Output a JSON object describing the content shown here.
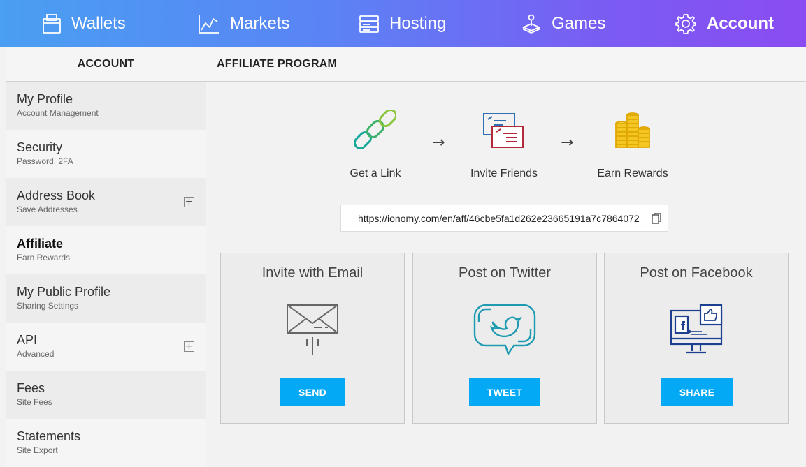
{
  "nav": {
    "items": [
      {
        "label": "Wallets",
        "icon": "wallet-icon"
      },
      {
        "label": "Markets",
        "icon": "chart-icon"
      },
      {
        "label": "Hosting",
        "icon": "server-icon"
      },
      {
        "label": "Games",
        "icon": "joystick-icon"
      },
      {
        "label": "Account",
        "icon": "gear-icon",
        "active": true
      }
    ]
  },
  "sidebar": {
    "header": "ACCOUNT",
    "items": [
      {
        "title": "My Profile",
        "sub": "Account Management"
      },
      {
        "title": "Security",
        "sub": "Password, 2FA"
      },
      {
        "title": "Address Book",
        "sub": "Save Addresses",
        "expandable": true
      },
      {
        "title": "Affiliate",
        "sub": "Earn Rewards",
        "active": true
      },
      {
        "title": "My Public Profile",
        "sub": "Sharing Settings"
      },
      {
        "title": "API",
        "sub": "Advanced",
        "expandable": true
      },
      {
        "title": "Fees",
        "sub": "Site Fees"
      },
      {
        "title": "Statements",
        "sub": "Site Export"
      }
    ]
  },
  "main": {
    "header": "AFFILIATE PROGRAM",
    "steps": [
      {
        "label": "Get a Link",
        "icon": "chain-link-icon"
      },
      {
        "label": "Invite Friends",
        "icon": "invite-cards-icon"
      },
      {
        "label": "Earn Rewards",
        "icon": "coins-icon"
      }
    ],
    "arrow": "→",
    "affiliate_link": "https://ionomy.com/en/aff/46cbe5fa1d262e23665191a7c7864072",
    "cards": [
      {
        "title": "Invite with Email",
        "button": "SEND",
        "icon": "envelope-icon"
      },
      {
        "title": "Post on Twitter",
        "button": "TWEET",
        "icon": "twitter-bubble-icon"
      },
      {
        "title": "Post on Facebook",
        "button": "SHARE",
        "icon": "facebook-monitor-icon"
      }
    ]
  },
  "colors": {
    "accent": "#03a9f4",
    "nav_gradient_start": "#4a9ff2",
    "nav_gradient_end": "#8a4cf2"
  }
}
